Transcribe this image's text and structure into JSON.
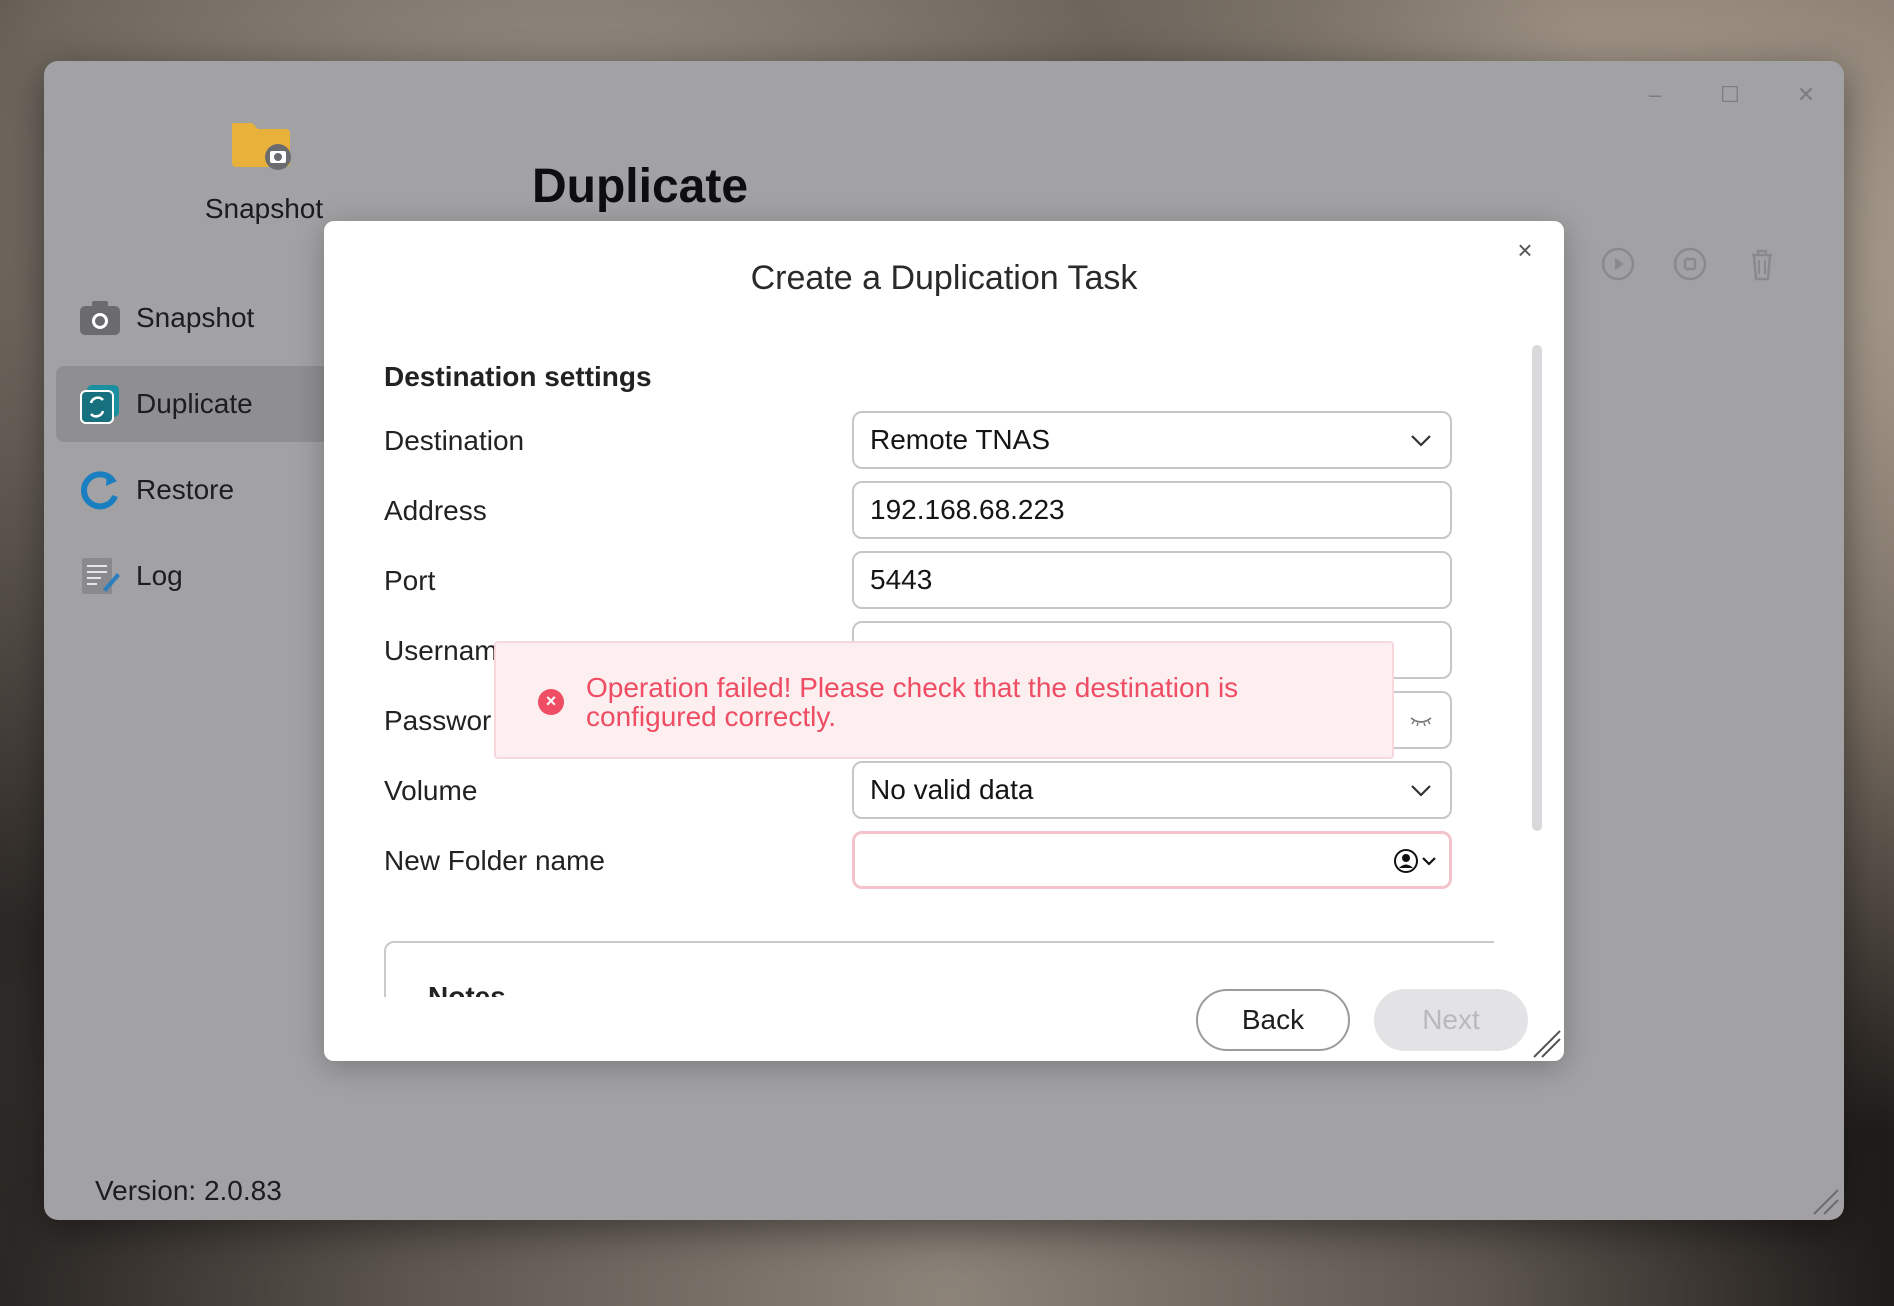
{
  "app": {
    "name": "Snapshot",
    "page_title": "Duplicate",
    "version": "Version: 2.0.83"
  },
  "sidebar": {
    "items": [
      {
        "label": "Snapshot",
        "icon": "camera-icon"
      },
      {
        "label": "Duplicate",
        "icon": "duplicate-icon",
        "active": true
      },
      {
        "label": "Restore",
        "icon": "restore-icon"
      },
      {
        "label": "Log",
        "icon": "log-icon"
      }
    ]
  },
  "toolbar": {
    "icons": [
      "play-icon",
      "stop-icon",
      "trash-icon"
    ]
  },
  "dialog": {
    "title": "Create a Duplication Task",
    "section_title": "Destination settings",
    "fields": {
      "destination": {
        "label": "Destination",
        "value": "Remote TNAS"
      },
      "address": {
        "label": "Address",
        "value": "192.168.68.223"
      },
      "port": {
        "label": "Port",
        "value": "5443"
      },
      "username": {
        "label": "Usernam",
        "value": ""
      },
      "password": {
        "label": "Passwor",
        "value": ""
      },
      "volume": {
        "label": "Volume",
        "value": "No valid data"
      },
      "new_folder": {
        "label": "New Folder name",
        "value": ""
      }
    },
    "notes_title": "Notes",
    "back_label": "Back",
    "next_label": "Next"
  },
  "toast": {
    "message": "Operation failed! Please check that the destination is configured correctly."
  },
  "colors": {
    "error": "#ee4d63",
    "accent": "#1a8fa0",
    "folder": "#e8b23a"
  }
}
